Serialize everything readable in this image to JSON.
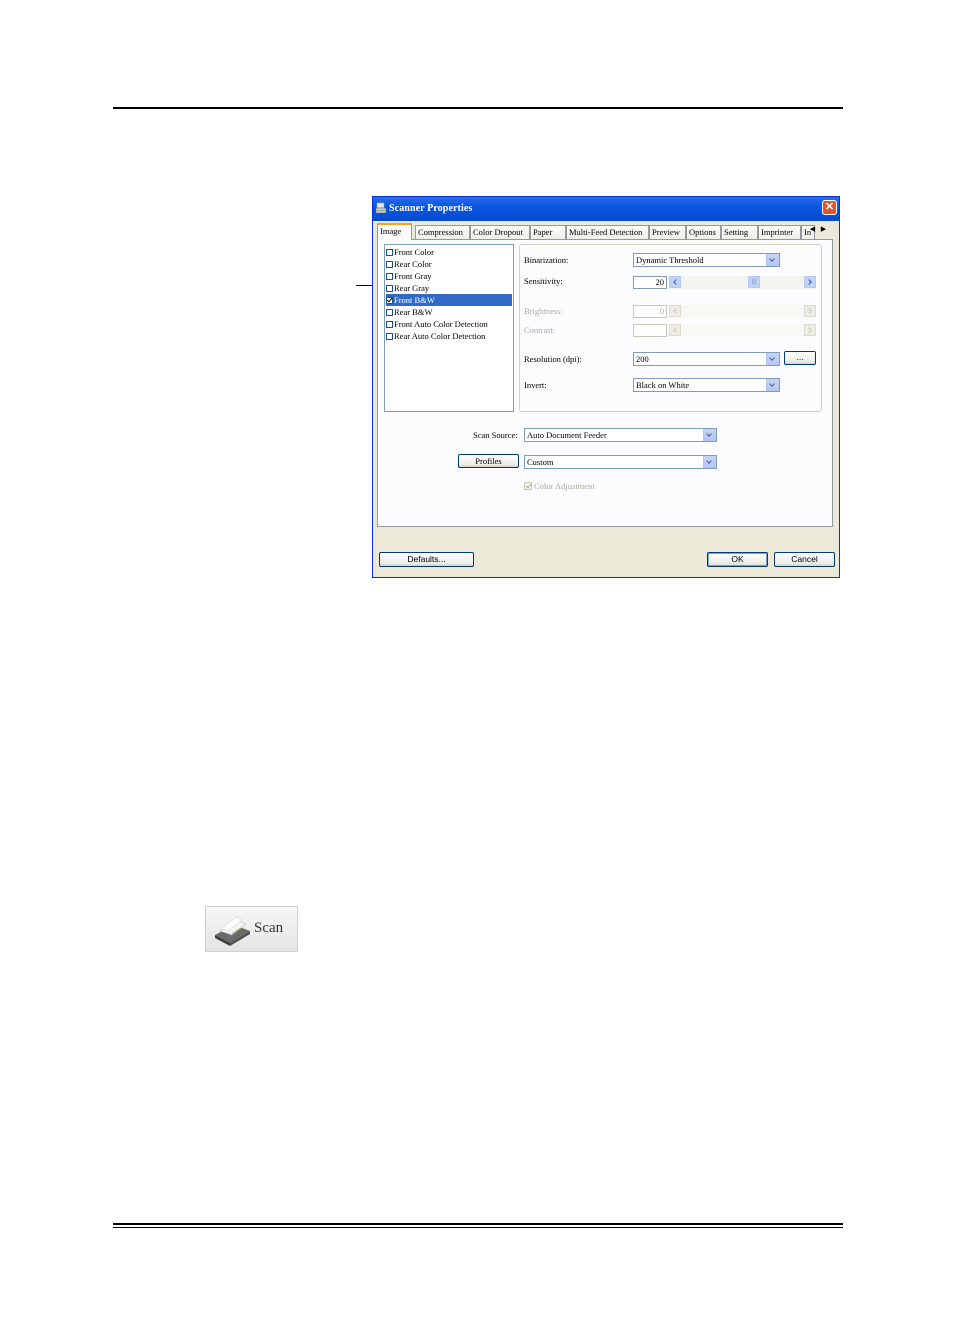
{
  "dialog": {
    "title": "Scanner Properties",
    "close_glyph": "✕",
    "tabs": [
      {
        "label": "Image",
        "active": true
      },
      {
        "label": "Compression",
        "active": false
      },
      {
        "label": "Color Dropout",
        "active": false
      },
      {
        "label": "Paper",
        "active": false
      },
      {
        "label": "Multi-Feed Detection",
        "active": false
      },
      {
        "label": "Preview",
        "active": false
      },
      {
        "label": "Options",
        "active": false
      },
      {
        "label": "Setting",
        "active": false
      },
      {
        "label": "Imprinter",
        "active": false
      },
      {
        "label": "In",
        "active": false
      }
    ],
    "tab_scroll_left": "◀",
    "tab_scroll_right": "▶",
    "image_list": [
      {
        "label": "Front Color",
        "checked": false,
        "selected": false
      },
      {
        "label": "Rear Color",
        "checked": false,
        "selected": false
      },
      {
        "label": "Front Gray",
        "checked": false,
        "selected": false
      },
      {
        "label": "Rear Gray",
        "checked": false,
        "selected": false
      },
      {
        "label": "Front B&W",
        "checked": true,
        "selected": true
      },
      {
        "label": "Rear B&W",
        "checked": false,
        "selected": false
      },
      {
        "label": "Front Auto Color Detection",
        "checked": false,
        "selected": false
      },
      {
        "label": "Rear Auto Color Detection",
        "checked": false,
        "selected": false
      }
    ],
    "settings": {
      "binarization_label": "Binarization:",
      "binarization_value": "Dynamic Threshold",
      "sensitivity_label": "Sensitivity:",
      "sensitivity_value": "20",
      "sensitivity_fraction": 0.6,
      "brightness_label": "Brightness:",
      "brightness_value": "0",
      "contrast_label": "Contrast:",
      "contrast_value": "",
      "resolution_label": "Resolution (dpi):",
      "resolution_value": "200",
      "resolution_more": "...",
      "invert_label": "Invert:",
      "invert_value": "Black on White"
    },
    "scan_source_label": "Scan Source:",
    "scan_source_value": "Auto Document Feeder",
    "profiles_button": "Profiles",
    "profiles_value": "Custom",
    "color_adjustment_label": "Color Adjustment",
    "defaults_button": "Defaults...",
    "ok_button": "OK",
    "cancel_button": "Cancel"
  },
  "scan_button": {
    "label": "Scan",
    "icon": "scanner-icon"
  }
}
